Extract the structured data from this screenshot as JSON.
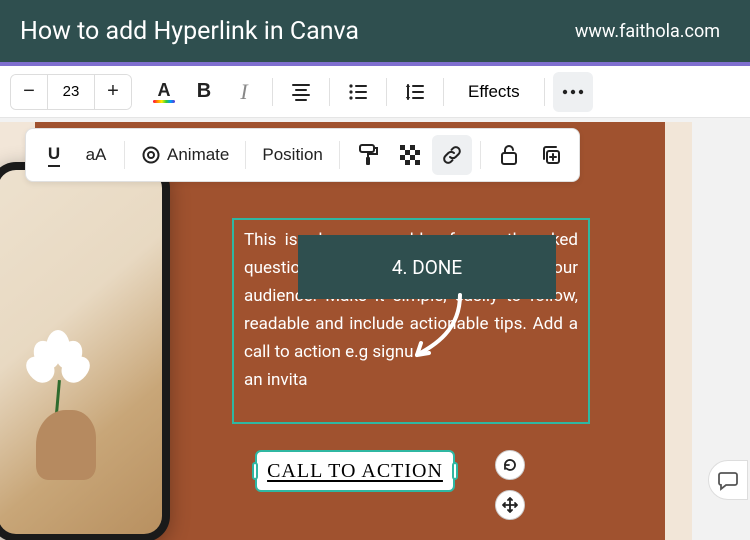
{
  "header": {
    "title": "How to add Hyperlink in Canva",
    "url": "www.faithola.com"
  },
  "main_toolbar": {
    "font_size": "23",
    "color_letter": "A",
    "bold_label": "B",
    "effects_label": "Effects"
  },
  "secondary_toolbar": {
    "underline_label": "U",
    "case_label": "aA",
    "animate_label": "Animate",
    "position_label": "Position"
  },
  "canvas": {
    "script_decor": "— — — — —",
    "body_text": "This is where you add a frequently asked question and explain it indepthly to your audience. Make it simple, easily to follow, readable and include actionable tips. Add a call to action e.g signu\nan invita",
    "cta_label": "CALL TO ACTION"
  },
  "annotation": {
    "label": "4. DONE"
  }
}
